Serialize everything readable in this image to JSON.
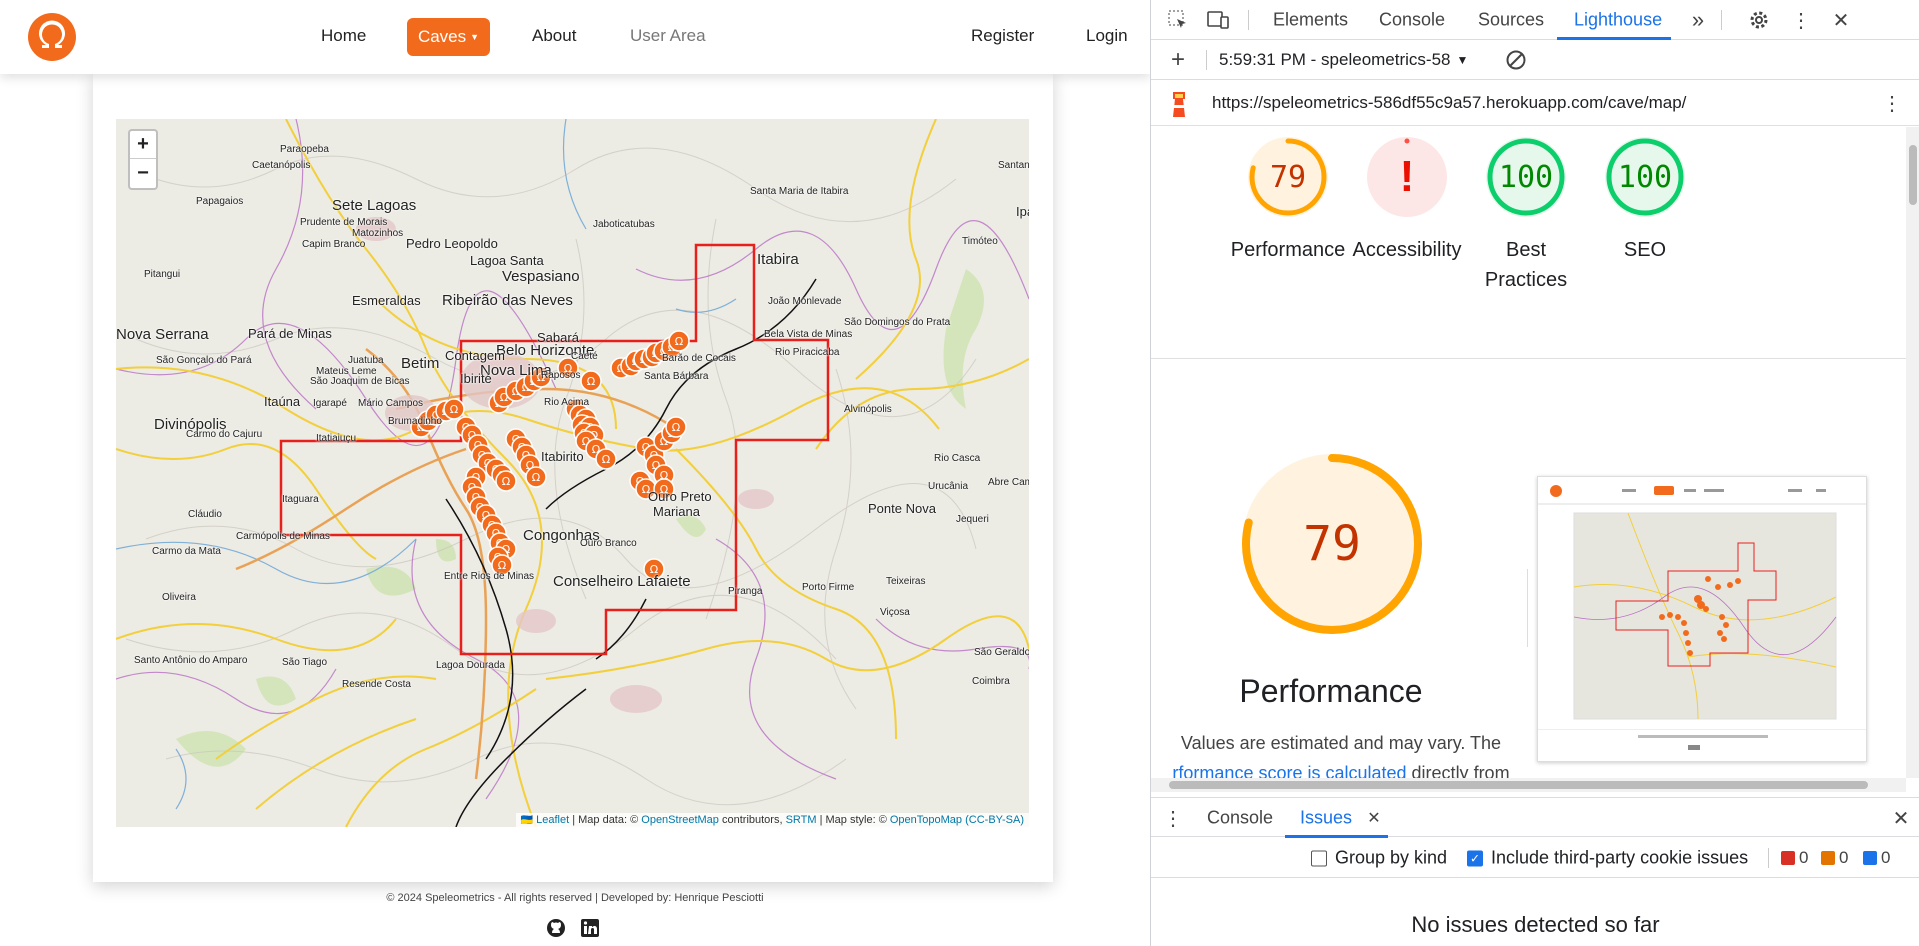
{
  "site": {
    "nav": {
      "home": "Home",
      "caves": "Caves",
      "about": "About",
      "user_area": "User Area",
      "register": "Register",
      "login": "Login"
    },
    "map": {
      "zoom_in": "+",
      "zoom_out": "−",
      "attribution": {
        "leaflet": "Leaflet",
        "map_data": "| Map data: ©",
        "osm": "OpenStreetMap",
        "contributors": "contributors,",
        "srtm": "SRTM",
        "style": "| Map style: ©",
        "opentopomap": "OpenTopoMap",
        "license": "(CC-BY-SA)"
      },
      "places": [
        "Paraopeba",
        "Caetanópolis",
        "Sete Lagoas",
        "Papagaios",
        "Prudente de Morais",
        "Matozinhos",
        "Capim Branco",
        "Pedro Leopoldo",
        "Lagoa Santa",
        "Vespasiano",
        "Jaboticatubas",
        "Santa Maria de Itabira",
        "Itabira",
        "Santana",
        "Timóteo",
        "Ipa",
        "Pitangui",
        "Esmeraldas",
        "Ribeirão das Neves",
        "Nova Serrana",
        "Pará de Minas",
        "Sabará",
        "Belo Horizonte",
        "Caeté",
        "Betim",
        "Contagem",
        "Nova Lima",
        "João Monlevade",
        "São Domingos do Prata",
        "Bela Vista de Minas",
        "Rio Piracicaba",
        "São Gonçalo do Pará",
        "Mateus Leme",
        "Juatuba",
        "Ibirité",
        "São Joaquim de Bicas",
        "Igarapé",
        "Mário Campos",
        "Itaúna",
        "Divinópolis",
        "Carmo do Cajuru",
        "Itatiaiuçu",
        "Brumadinho",
        "Raposos",
        "Rio Acima",
        "Santa Bárbara",
        "Barão de Cocais",
        "Alvinópolis",
        "Itabirito",
        "Rio Casca",
        "Urucânia",
        "Abre Campo",
        "Itaguara",
        "Cláudio",
        "Carmópolis de Minas",
        "Carmo da Mata",
        "Ouro Preto",
        "Mariana",
        "Ponte Nova",
        "Jequeri",
        "Congonhas",
        "Ouro Branco",
        "Conselheiro Lafaiete",
        "Entre Rios de Minas",
        "Teixeiras",
        "Oliveira",
        "Piranga",
        "Porto Firme",
        "Viçosa",
        "Santo Antônio do Amparo",
        "São Tiago",
        "Lagoa Dourada",
        "Resende Costa",
        "São Geraldo",
        "Coimbra"
      ]
    },
    "footer": "© 2024 Speleometrics - All rights reserved | Developed by: Henrique Pesciotti",
    "social": [
      "github-icon",
      "linkedin-icon"
    ],
    "accent_color": "#f26b1d"
  },
  "devtools": {
    "tabs": [
      "Elements",
      "Console",
      "Sources",
      "Lighthouse"
    ],
    "active_tab": "Lighthouse",
    "report_selector": "5:59:31 PM - speleometrics-58",
    "url": "https://speleometrics-586df55c9a57.herokuapp.com/cave/map/",
    "scores": [
      {
        "label": "Performance",
        "value": "79",
        "fraction": 0.79,
        "color": "#ffa400",
        "text_color": "#c33300",
        "bg": "#fff3e0"
      },
      {
        "label": "Accessibility",
        "value": "!",
        "fraction": 0,
        "color": "#ff4e42",
        "text_color": "#eb0f00",
        "bg": "#fde7e6"
      },
      {
        "label": "Best Practices",
        "value": "100",
        "fraction": 1.0,
        "color": "#0cce6b",
        "text_color": "#008800",
        "bg": "#e6f8ec"
      },
      {
        "label": "SEO",
        "value": "100",
        "fraction": 1.0,
        "color": "#0cce6b",
        "text_color": "#008800",
        "bg": "#e6f8ec"
      }
    ],
    "performance": {
      "value": "79",
      "fraction": 0.79,
      "title": "Performance",
      "desc_1": "Values are estimated and may vary. The",
      "desc_link": "rformance score is calculated",
      "desc_2": "directly from these"
    },
    "drawer": {
      "tabs": [
        "Console",
        "Issues"
      ],
      "active": "Issues",
      "group_by_kind": "Group by kind",
      "group_by_kind_checked": false,
      "third_party": "Include third-party cookie issues",
      "third_party_checked": true,
      "counts": {
        "errors": "0",
        "warnings": "0",
        "info": "0"
      },
      "empty_message": "No issues detected so far"
    }
  }
}
